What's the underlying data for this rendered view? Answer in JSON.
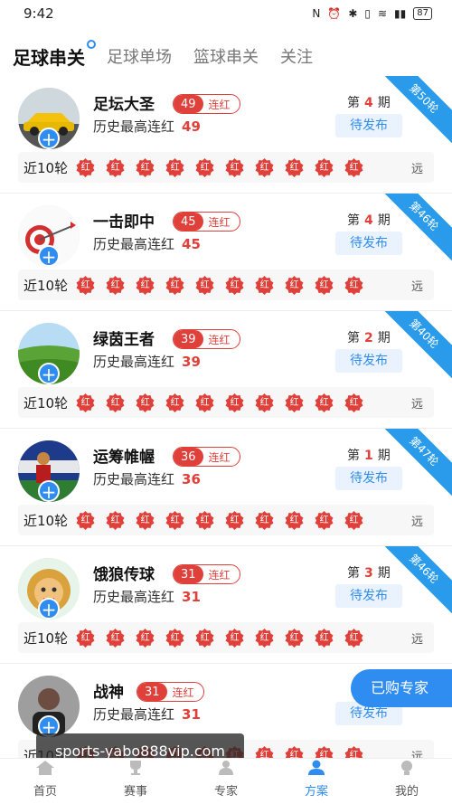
{
  "status_bar": {
    "time": "9:42",
    "battery": "87"
  },
  "tabs": [
    {
      "label": "足球串关",
      "active": true
    },
    {
      "label": "足球单场",
      "active": false
    },
    {
      "label": "篮球串关",
      "active": false
    },
    {
      "label": "关注",
      "active": false
    }
  ],
  "common": {
    "streak_suffix": "连红",
    "history_label": "历史最高连红",
    "period_prefix": "第",
    "period_suffix": "期",
    "pending_label": "待发布",
    "recent_label": "近10轮",
    "badge_text": "红",
    "far_text": "远"
  },
  "experts": [
    {
      "name": "足坛大圣",
      "streak": "49",
      "history": "49",
      "period": "4",
      "ribbon": "第50轮"
    },
    {
      "name": "一击即中",
      "streak": "45",
      "history": "45",
      "period": "4",
      "ribbon": "第46轮"
    },
    {
      "name": "绿茵王者",
      "streak": "39",
      "history": "39",
      "period": "2",
      "ribbon": "第40轮"
    },
    {
      "name": "运筹帷幄",
      "streak": "36",
      "history": "36",
      "period": "1",
      "ribbon": "第47轮"
    },
    {
      "name": "饿狼传球",
      "streak": "31",
      "history": "31",
      "period": "3",
      "ribbon": "第46轮"
    },
    {
      "name": "战神",
      "streak": "31",
      "history": "31",
      "period": "",
      "ribbon": ""
    }
  ],
  "floating_button": "已购专家",
  "watermark": "sports-yabo888vip.com",
  "bottom_nav": [
    {
      "label": "首页",
      "icon": "home-icon",
      "active": false
    },
    {
      "label": "赛事",
      "icon": "trophy-icon",
      "active": false
    },
    {
      "label": "专家",
      "icon": "expert-icon",
      "active": false
    },
    {
      "label": "方案",
      "icon": "plan-icon",
      "active": true
    },
    {
      "label": "我的",
      "icon": "profile-icon",
      "active": false
    }
  ],
  "colors": {
    "accent": "#2f8cf0",
    "red": "#e0403a",
    "ribbon": "#2a9bea"
  }
}
